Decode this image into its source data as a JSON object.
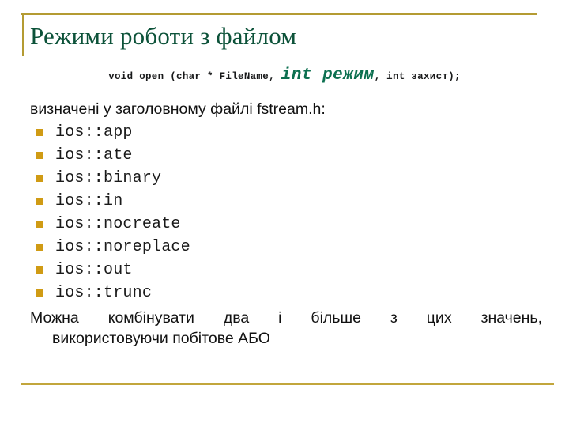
{
  "slide": {
    "title": "Режими роботи з файлом",
    "code_signature": {
      "prefix": "void open (char * FileName,",
      "highlight": "int режим",
      "suffix": ", int захист);"
    },
    "intro": "визначені у заголовному файлі fstream.h:",
    "modes": [
      {
        "bullet": "square-bullet-icon",
        "label": "ios::app"
      },
      {
        "bullet": "square-bullet-icon",
        "label": "ios::ate"
      },
      {
        "bullet": "square-bullet-icon",
        "label": "ios::binary"
      },
      {
        "bullet": "square-bullet-icon",
        "label": "ios::in"
      },
      {
        "bullet": "square-bullet-icon",
        "label": "ios::nocreate"
      },
      {
        "bullet": "square-bullet-icon",
        "label": "ios::noreplace"
      },
      {
        "bullet": "square-bullet-icon",
        "label": "ios::out"
      },
      {
        "bullet": "square-bullet-icon",
        "label": "ios::trunc"
      }
    ],
    "outro": {
      "line1": "Можна комбінувати два і більше з цих значень,",
      "line2": "використовуючи побітове АБО"
    }
  },
  "colors": {
    "title_green": "#0c5239",
    "code_highlight_green": "#0c7050",
    "rule_gold": "#b49b33",
    "rule_gold_bottom": "#c2a63c",
    "bullet_gold": "#d09b14",
    "body_text": "#111111",
    "background": "#ffffff"
  }
}
